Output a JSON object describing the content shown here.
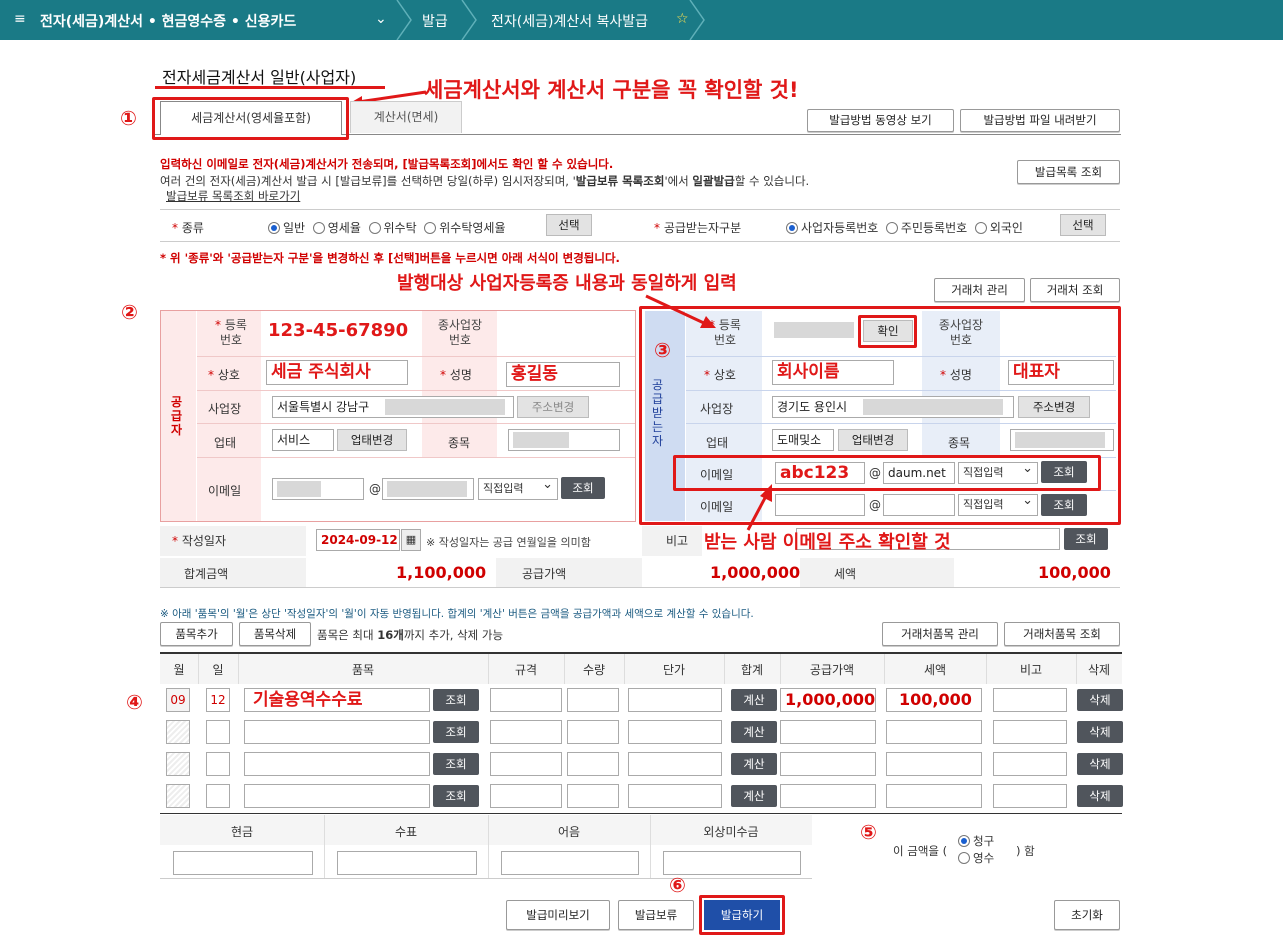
{
  "topbar": {
    "menu_icon": "menu-icon",
    "title": "전자(세금)계산서 • 현금영수증 • 신용카드",
    "crumb1": "발급",
    "crumb2": "전자(세금)계산서 복사발급",
    "star_icon": "star-icon"
  },
  "page_title": "전자세금계산서 일반(사업자)",
  "tabs": [
    "세금계산서(영세율포함)",
    "계산서(면세)"
  ],
  "top_buttons": {
    "video": "발급방법 동영상 보기",
    "file": "발급방법 파일 내려받기",
    "list": "발급목록 조회"
  },
  "notice": {
    "line1": "입력하신 이메일로 전자(세금)계산서가 전송되며, [발급목록조회]에서도 확인 할 수 있습니다.",
    "line2a": "여러 건의 전자(세금)계산서 발급 시 [발급보류]를 선택하면 당일(하루) 임시저장되며, '",
    "line2b": "발급보류 목록조회",
    "line2c": "'에서 ",
    "line2d": "일괄발급",
    "line2e": "할 수 있습니다.",
    "link": "발급보류 목록조회 바로가기"
  },
  "kind": {
    "label": "종류",
    "options": [
      "일반",
      "영세율",
      "위수탁",
      "위수탁영세율"
    ],
    "select": "선택",
    "recv_label": "공급받는자구분",
    "recv_options": [
      "사업자등록번호",
      "주민등록번호",
      "외국인"
    ],
    "recv_select": "선택"
  },
  "warn": "* 위 '종류'와 '공급받는자 구분'을 변경하신 후 [선택]버튼을 누르시면 아래 서식이 변경됩니다.",
  "client_buttons": {
    "manage": "거래처 관리",
    "search": "거래처 조회"
  },
  "supplier": {
    "side": "공급자",
    "reg_label": "등록\n번호",
    "reg_value": "123-45-67890",
    "sub_label": "종사업장\n번호",
    "name_label": "상호",
    "name_value": "세금 주식회사",
    "ceo_label": "성명",
    "ceo_value": "홍길동",
    "addr_label": "사업장",
    "addr_value": "서울특별시 강남구",
    "addr_btn": "주소변경",
    "biz_label": "업태",
    "biz_value": "서비스",
    "biz_btn": "업태변경",
    "item_label": "종목",
    "email_label": "이메일",
    "at": "@",
    "direct": "직접입력",
    "query": "조회"
  },
  "receiver": {
    "side": "공급받는자",
    "reg_label": "등록\n번호",
    "confirm": "확인",
    "sub_label": "종사업장\n번호",
    "name_label": "상호",
    "name_value": "회사이름",
    "ceo_label": "성명",
    "ceo_value": "대표자",
    "addr_label": "사업장",
    "addr_value": "경기도 용인시",
    "addr_btn": "주소변경",
    "biz_label": "업태",
    "biz_value": "도매및소",
    "biz_btn": "업태변경",
    "item_label": "종목",
    "email_label": "이메일",
    "email_id": "abc123",
    "at": "@",
    "domain": "daum.net",
    "direct": "직접입력",
    "query": "조회",
    "email2_label": "이메일"
  },
  "date_row": {
    "label": "작성일자",
    "value": "2024-09-12",
    "note": "※ 작성일자는 공급 연월일을 의미함",
    "remark_label": "비고",
    "query": "조회"
  },
  "totals": {
    "sum_label": "합계금액",
    "sum_value": "1,100,000",
    "supply_label": "공급가액",
    "supply_value": "1,000,000",
    "tax_label": "세액",
    "tax_value": "100,000"
  },
  "items_note": "※ 아래 '품목'의 '월'은 상단 '작성일자'의 '월'이 자동 반영됩니다. 합계의 '계산' 버튼은 금액을 공급가액과 세액으로 계산할 수 있습니다.",
  "items_buttons": {
    "add": "품목추가",
    "del": "품목삭제",
    "limit_a": "품목은 최대 ",
    "limit_b": "16개",
    "limit_c": "까지 추가, 삭제 가능",
    "manage": "거래처품목 관리",
    "search": "거래처품목 조회"
  },
  "grid": {
    "headers": [
      "월",
      "일",
      "품목",
      "규격",
      "수량",
      "단가",
      "합계",
      "공급가액",
      "세액",
      "비고",
      "삭제"
    ],
    "row1": {
      "month": "09",
      "day": "12",
      "item": "기술용역수수료",
      "supply": "1,000,000",
      "tax": "100,000"
    },
    "query": "조회",
    "calc": "계산",
    "delete": "삭제"
  },
  "payment": {
    "headers": [
      "현금",
      "수표",
      "어음",
      "외상미수금"
    ],
    "prefix": "이 금액을 (",
    "opt1": "청구",
    "opt2": "영수",
    "suffix": ") 함"
  },
  "bottom": {
    "preview": "발급미리보기",
    "hold": "발급보류",
    "issue": "발급하기",
    "reset": "초기화"
  },
  "annotations": {
    "a1": "세금계산서와 계산서 구분을 꼭 확인할 것!",
    "a2": "발행대상 사업자등록증 내용과 동일하게 입력",
    "a3": "받는 사람 이메일 주소 확인할 것",
    "n1": "①",
    "n2": "②",
    "n3": "③",
    "n4": "④",
    "n5": "⑤",
    "n6": "⑥"
  },
  "colors": {
    "topbar": "#1a7a86",
    "accent_red": "#e01818",
    "issue_btn": "#1f4fa8"
  }
}
